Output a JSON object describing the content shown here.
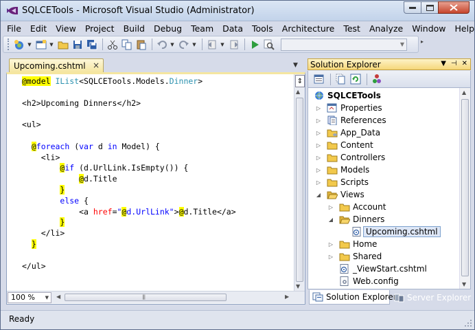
{
  "window": {
    "title": "SQLCETools - Microsoft Visual Studio (Administrator)"
  },
  "menu": [
    "File",
    "Edit",
    "View",
    "Project",
    "Build",
    "Debug",
    "Team",
    "Data",
    "Tools",
    "Architecture",
    "Test",
    "Analyze",
    "Window",
    "Help"
  ],
  "toolbar": {
    "icons": [
      "new-project-icon",
      "add-item-icon",
      "open-file-icon",
      "save-icon",
      "save-all-icon",
      "cut-icon",
      "copy-icon",
      "paste-icon",
      "undo-icon",
      "redo-icon",
      "navigate-backward-icon",
      "navigate-forward-icon",
      "start-debugging-icon",
      "find-icon"
    ],
    "config_value": ""
  },
  "editor": {
    "tab_label": "Upcoming.cshtml",
    "tab_close": "×",
    "zoom": "100 %",
    "code": {
      "l1": "@model IList<SQLCETools.Models.Dinner>",
      "l3": "<h2>Upcoming Dinners</h2>",
      "l5": "<ul>",
      "l7": "@foreach (var d in Model) {",
      "l8": "<li>",
      "l9": "@if (d.UrlLink.IsEmpty()) {",
      "l10": "@d.Title",
      "l11": "}",
      "l12": "else {",
      "l13": "<a href=\"@d.UrlLink\">@d.Title</a>",
      "l14": "}",
      "l15": "</li>",
      "l16": "}",
      "l18": "</ul>"
    }
  },
  "solution_explorer": {
    "title": "Solution Explorer",
    "header_controls": [
      "▼",
      "📌",
      "×"
    ],
    "tree": [
      {
        "label": "SQLCETools",
        "icon": "web-project-icon"
      },
      {
        "label": "Properties",
        "icon": "properties-icon"
      },
      {
        "label": "References",
        "icon": "references-icon"
      },
      {
        "label": "App_Data",
        "icon": "folder-icon"
      },
      {
        "label": "Content",
        "icon": "folder-icon"
      },
      {
        "label": "Controllers",
        "icon": "folder-icon"
      },
      {
        "label": "Models",
        "icon": "folder-icon"
      },
      {
        "label": "Scripts",
        "icon": "folder-icon"
      },
      {
        "label": "Views",
        "icon": "folder-open-icon"
      },
      {
        "label": "Account",
        "icon": "folder-icon"
      },
      {
        "label": "Dinners",
        "icon": "folder-open-icon"
      },
      {
        "label": "Upcoming.cshtml",
        "icon": "cshtml-file-icon"
      },
      {
        "label": "Home",
        "icon": "folder-icon"
      },
      {
        "label": "Shared",
        "icon": "folder-icon"
      },
      {
        "label": "_ViewStart.cshtml",
        "icon": "cshtml-file-icon"
      },
      {
        "label": "Web.config",
        "icon": "config-file-icon"
      }
    ],
    "tabs": [
      "Solution Explorer",
      "Server Explorer"
    ]
  },
  "status": {
    "text": "Ready"
  },
  "colors": {
    "title_bar": "#c2d3ea",
    "razor_highlight": "#ffff00",
    "keyword": "#0000ff",
    "type": "#2b91af",
    "tag": "#a31515",
    "attribute": "#ff0000",
    "panel_header": "#f6d77a",
    "folder": "#f2c94c"
  }
}
